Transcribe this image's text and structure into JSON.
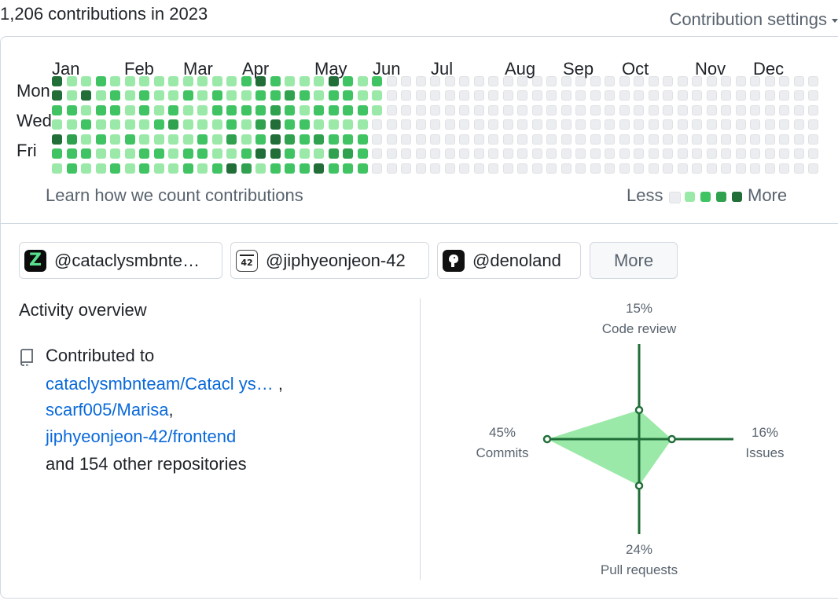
{
  "header": {
    "contributions_title": "1,206 contributions in 2023",
    "settings_label": "Contribution settings"
  },
  "calendar": {
    "months": [
      "Jan",
      "Feb",
      "Mar",
      "Apr",
      "May",
      "Jun",
      "Jul",
      "Aug",
      "Sep",
      "Oct",
      "Nov",
      "Dec"
    ],
    "days": [
      "Mon",
      "Wed",
      "Fri"
    ],
    "learn_link": "Learn how we count contributions",
    "legend_less": "Less",
    "legend_more": "More",
    "level_colors": [
      "#ebedf0",
      "#9be9a8",
      "#40c463",
      "#30a14e",
      "#216e39"
    ],
    "weeks": [
      [
        4,
        4,
        2,
        1,
        4,
        2,
        1
      ],
      [
        1,
        1,
        2,
        1,
        3,
        2,
        2
      ],
      [
        1,
        4,
        1,
        2,
        1,
        2,
        1
      ],
      [
        2,
        1,
        2,
        1,
        2,
        1,
        1
      ],
      [
        1,
        2,
        2,
        1,
        1,
        1,
        2
      ],
      [
        1,
        1,
        1,
        1,
        2,
        1,
        1
      ],
      [
        1,
        2,
        2,
        1,
        1,
        2,
        2
      ],
      [
        1,
        1,
        1,
        2,
        1,
        2,
        1
      ],
      [
        1,
        1,
        2,
        3,
        1,
        1,
        1
      ],
      [
        1,
        2,
        1,
        1,
        1,
        2,
        2
      ],
      [
        1,
        1,
        1,
        1,
        2,
        2,
        1
      ],
      [
        1,
        2,
        2,
        1,
        1,
        1,
        2
      ],
      [
        1,
        1,
        2,
        2,
        3,
        1,
        4
      ],
      [
        2,
        1,
        2,
        1,
        1,
        2,
        3
      ],
      [
        4,
        2,
        2,
        3,
        2,
        4,
        1
      ],
      [
        2,
        2,
        3,
        4,
        4,
        4,
        2
      ],
      [
        1,
        3,
        2,
        2,
        3,
        2,
        2
      ],
      [
        1,
        2,
        1,
        2,
        2,
        1,
        2
      ],
      [
        1,
        1,
        2,
        1,
        3,
        1,
        4
      ],
      [
        4,
        2,
        2,
        1,
        2,
        3,
        2
      ],
      [
        2,
        2,
        2,
        1,
        2,
        3,
        2
      ],
      [
        1,
        1,
        2,
        1,
        2,
        2,
        2
      ],
      [
        2,
        1,
        1,
        0,
        0,
        0,
        0
      ],
      [
        0,
        0,
        0,
        0,
        0,
        0,
        0
      ],
      [
        0,
        0,
        0,
        0,
        0,
        0,
        0
      ],
      [
        0,
        0,
        0,
        0,
        0,
        0,
        0
      ],
      [
        0,
        0,
        0,
        0,
        0,
        0,
        0
      ],
      [
        0,
        0,
        0,
        0,
        0,
        0,
        0
      ],
      [
        0,
        0,
        0,
        0,
        0,
        0,
        0
      ],
      [
        0,
        0,
        0,
        0,
        0,
        0,
        0
      ],
      [
        0,
        0,
        0,
        0,
        0,
        0,
        0
      ],
      [
        0,
        0,
        0,
        0,
        0,
        0,
        0
      ],
      [
        0,
        0,
        0,
        0,
        0,
        0,
        0
      ],
      [
        0,
        0,
        0,
        0,
        0,
        0,
        0
      ],
      [
        0,
        0,
        0,
        0,
        0,
        0,
        0
      ],
      [
        0,
        0,
        0,
        0,
        0,
        0,
        0
      ],
      [
        0,
        0,
        0,
        0,
        0,
        0,
        0
      ],
      [
        0,
        0,
        0,
        0,
        0,
        0,
        0
      ],
      [
        0,
        0,
        0,
        0,
        0,
        0,
        0
      ],
      [
        0,
        0,
        0,
        0,
        0,
        0,
        0
      ],
      [
        0,
        0,
        0,
        0,
        0,
        0,
        0
      ],
      [
        0,
        0,
        0,
        0,
        0,
        0,
        0
      ],
      [
        0,
        0,
        0,
        0,
        0,
        0,
        0
      ],
      [
        0,
        0,
        0,
        0,
        0,
        0,
        0
      ],
      [
        0,
        0,
        0,
        0,
        0,
        0,
        0
      ],
      [
        0,
        0,
        0,
        0,
        0,
        0,
        0
      ],
      [
        0,
        0,
        0,
        0,
        0,
        0,
        0
      ],
      [
        0,
        0,
        0,
        0,
        0,
        0,
        0
      ],
      [
        0,
        0,
        0,
        0,
        0,
        0,
        0
      ],
      [
        0,
        0,
        0,
        0,
        0,
        0,
        0
      ],
      [
        0,
        0,
        0,
        0,
        0,
        0,
        0
      ],
      [
        0,
        0,
        0,
        0,
        0,
        0,
        0
      ],
      [
        0,
        0,
        0,
        0,
        0,
        0,
        0
      ]
    ]
  },
  "organizations": [
    {
      "label": "@cataclysmbnte…",
      "icon": "z-logo-icon"
    },
    {
      "label": "@jiphyeonjeon-42",
      "icon": "42-logo-icon"
    },
    {
      "label": "@denoland",
      "icon": "deno-logo-icon"
    }
  ],
  "more_button": "More",
  "activity": {
    "title": "Activity overview",
    "contributed_to": "Contributed to",
    "repos": [
      "cataclysmbnteam/Catacl ys…",
      "scarf005/Marisa",
      "jiphyeonjeon-42/frontend"
    ],
    "repo_separators": [
      ",",
      ","
    ],
    "other_repos": "and 154 other repositories"
  },
  "radar": {
    "fill_color": "#9be9a8",
    "stroke_color": "#216e39",
    "axes": {
      "code_review": {
        "label": "Code review",
        "percent": "15%",
        "value": 15
      },
      "issues": {
        "label": "Issues",
        "percent": "16%",
        "value": 16
      },
      "pull_requests": {
        "label": "Pull requests",
        "percent": "24%",
        "value": 24
      },
      "commits": {
        "label": "Commits",
        "percent": "45%",
        "value": 45
      }
    }
  }
}
